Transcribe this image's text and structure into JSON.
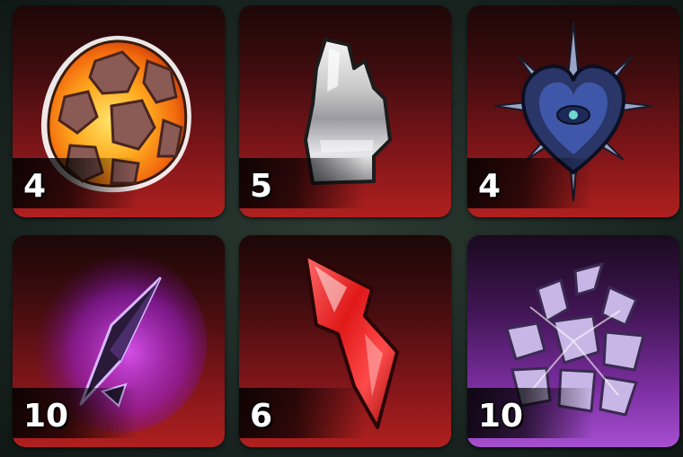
{
  "inventory": {
    "slots": [
      {
        "item_icon": "lava-egg-icon",
        "count": "4",
        "rarity_color": "#a81f20"
      },
      {
        "item_icon": "silver-crystal-icon",
        "count": "5",
        "rarity_color": "#a81f20"
      },
      {
        "item_icon": "spiked-dark-heart-icon",
        "count": "4",
        "rarity_color": "#a81f20"
      },
      {
        "item_icon": "purple-shard-icon",
        "count": "10",
        "rarity_color": "#a81f20"
      },
      {
        "item_icon": "red-crystal-icon",
        "count": "6",
        "rarity_color": "#a81f20"
      },
      {
        "item_icon": "shattered-glass-icon",
        "count": "10",
        "rarity_color": "#a64fd0"
      }
    ]
  }
}
